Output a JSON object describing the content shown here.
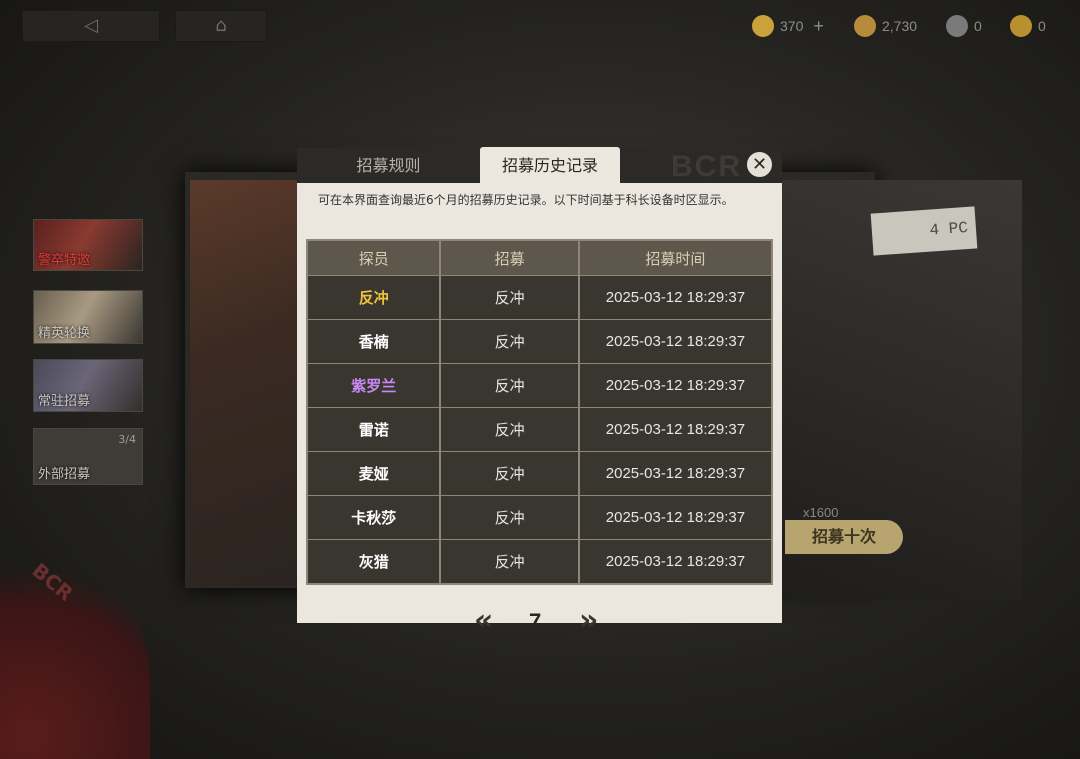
{
  "topbar": {
    "currencies": [
      {
        "icon": "gem-icon",
        "value": "370",
        "color": "#c9a23a",
        "has_plus": true
      },
      {
        "icon": "gold-coin-icon",
        "value": "2,730",
        "color": "#b88b3a"
      },
      {
        "icon": "ticket-icon",
        "value": "0",
        "color": "#7a7a7a"
      },
      {
        "icon": "special-ticket-icon",
        "value": "0",
        "color": "#b8902f"
      }
    ]
  },
  "banners": [
    {
      "label": "警卒特邀",
      "count": ""
    },
    {
      "label": "精英轮换",
      "count": ""
    },
    {
      "label": "常驻招募",
      "count": ""
    },
    {
      "label": "外部招募",
      "count": "3/4"
    }
  ],
  "background": {
    "tape_label": "4 PC",
    "disk_label": "BCR",
    "ten_pull_label": "招募十次",
    "ten_pull_cost": "x1600"
  },
  "modal": {
    "tabs": [
      {
        "label": "招募规则",
        "active": false
      },
      {
        "label": "招募历史记录",
        "active": true
      }
    ],
    "close": "✕",
    "description": "可在本界面查询最近6个月的招募历史记录。以下时间基于科长设备时区显示。",
    "columns": [
      "探员",
      "招募",
      "招募时间"
    ],
    "rows": [
      {
        "agent": "反冲",
        "banner": "反冲",
        "time": "2025-03-12 18:29:37",
        "color": "#f2c23a"
      },
      {
        "agent": "香楠",
        "banner": "反冲",
        "time": "2025-03-12 18:29:37",
        "color": "#ffffff"
      },
      {
        "agent": "紫罗兰",
        "banner": "反冲",
        "time": "2025-03-12 18:29:37",
        "color": "#c78af2"
      },
      {
        "agent": "雷诺",
        "banner": "反冲",
        "time": "2025-03-12 18:29:37",
        "color": "#ffffff"
      },
      {
        "agent": "麦娅",
        "banner": "反冲",
        "time": "2025-03-12 18:29:37",
        "color": "#ffffff"
      },
      {
        "agent": "卡秋莎",
        "banner": "反冲",
        "time": "2025-03-12 18:29:37",
        "color": "#ffffff"
      },
      {
        "agent": "灰猎",
        "banner": "反冲",
        "time": "2025-03-12 18:29:37",
        "color": "#ffffff"
      }
    ],
    "pager": {
      "prev": "«",
      "page": "7",
      "next": "»"
    }
  }
}
